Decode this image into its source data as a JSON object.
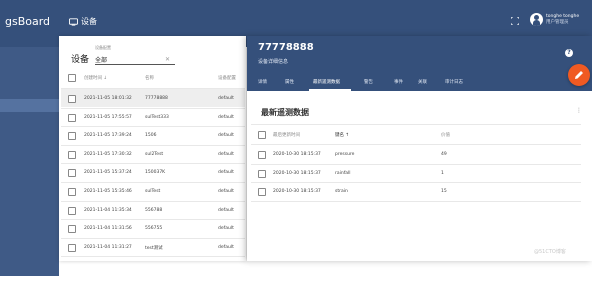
{
  "topbar": {
    "brand": "gsBoard",
    "breadcrumb": "设备",
    "user_name": "tonghe tonghe",
    "user_role": "用户管理员"
  },
  "left_panel": {
    "title": "设备",
    "filter_label": "设备配置",
    "filter_value": "全部",
    "columns": [
      "创建时间 ↓",
      "名称",
      "设备配置"
    ],
    "rows": [
      {
        "created": "2021-11-05 18:01:32",
        "name": "77778888",
        "profile": "default"
      },
      {
        "created": "2021-11-05 17:55:57",
        "name": "sulTest333",
        "profile": "default"
      },
      {
        "created": "2021-11-05 17:39:24",
        "name": "1506",
        "profile": "default"
      },
      {
        "created": "2021-11-05 17:30:32",
        "name": "sul2Test",
        "profile": "default"
      },
      {
        "created": "2021-11-05 15:37:24",
        "name": "150037K",
        "profile": "default"
      },
      {
        "created": "2021-11-05 15:35:46",
        "name": "sulTest",
        "profile": "default"
      },
      {
        "created": "2021-11-04 11:35:34",
        "name": "556788",
        "profile": "default"
      },
      {
        "created": "2021-11-04 11:31:56",
        "name": "556755",
        "profile": "default"
      },
      {
        "created": "2021-11-04 11:31:27",
        "name": "test测试",
        "profile": "default"
      }
    ]
  },
  "drawer": {
    "title": "77778888",
    "subtitle": "设备详细信息",
    "tabs": [
      "详情",
      "属性",
      "最新遥测数据",
      "警告",
      "事件",
      "关联",
      "审计日志"
    ],
    "active_tab": "最新遥测数据",
    "section_title": "最新遥测数据",
    "columns": [
      "最后更新时间",
      "键名 ↑",
      "价值"
    ],
    "rows": [
      {
        "updated": "2020-10-30 18:15:37",
        "key": "pressure",
        "value": "49"
      },
      {
        "updated": "2020-10-30 18:15:37",
        "key": "rainfall",
        "value": "1"
      },
      {
        "updated": "2020-10-30 18:15:37",
        "key": "strain",
        "value": "15"
      }
    ]
  },
  "watermark": "@51CTO博客",
  "colors": {
    "primary": "#35507b",
    "accent": "#f05a22"
  }
}
